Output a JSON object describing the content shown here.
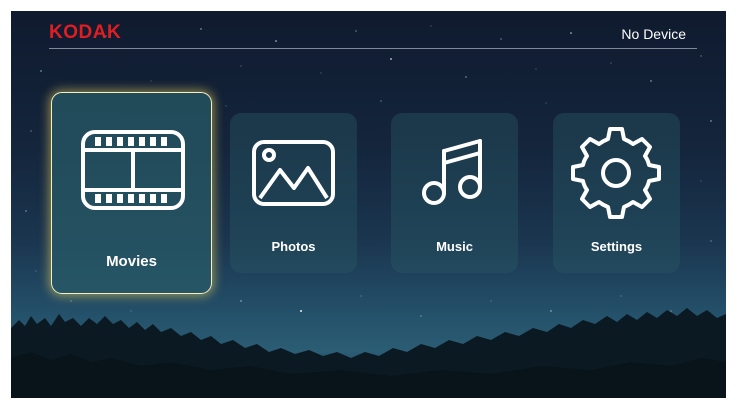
{
  "header": {
    "logo": "KODAK",
    "device_status": "No Device"
  },
  "menu": {
    "items": [
      {
        "id": "movies",
        "label": "Movies",
        "icon": "film-icon",
        "selected": true
      },
      {
        "id": "photos",
        "label": "Photos",
        "icon": "image-icon",
        "selected": false
      },
      {
        "id": "music",
        "label": "Music",
        "icon": "music-note-icon",
        "selected": false
      },
      {
        "id": "settings",
        "label": "Settings",
        "icon": "gear-icon",
        "selected": false
      }
    ]
  },
  "colors": {
    "brand": "#e11d22",
    "focus_glow": "#f0d75a",
    "tile": "#285864",
    "text": "#ffffff"
  }
}
